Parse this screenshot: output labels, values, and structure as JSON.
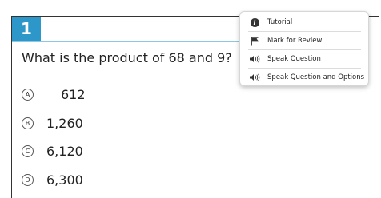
{
  "question": {
    "number": "1",
    "stem": "What is the product of 68 and 9?"
  },
  "options": [
    {
      "letter": "A",
      "value": "612"
    },
    {
      "letter": "B",
      "value": "1,260"
    },
    {
      "letter": "C",
      "value": "6,120"
    },
    {
      "letter": "D",
      "value": "6,300"
    }
  ],
  "context_menu": {
    "items": [
      {
        "label": "Tutorial",
        "icon": "info-icon"
      },
      {
        "label": "Mark for Review",
        "icon": "flag-icon"
      },
      {
        "label": "Speak Question",
        "icon": "speaker-icon"
      },
      {
        "label": "Speak Question and Options",
        "icon": "speaker-icon"
      }
    ]
  },
  "colors": {
    "question_number_bg": "#2e97c9",
    "underline": "#8cc7e3"
  }
}
